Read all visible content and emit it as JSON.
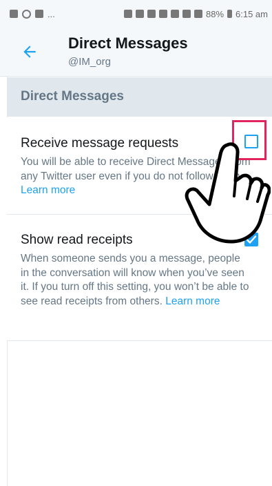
{
  "status_bar": {
    "left_dots": "...",
    "battery": "88%",
    "time": "6:15 am"
  },
  "header": {
    "title": "Direct Messages",
    "subtitle": "@IM_org"
  },
  "section": {
    "title": "Direct Messages"
  },
  "settings": [
    {
      "title": "Receive message requests",
      "description": "You will be able to receive Direct Messages from any Twitter user even if you do not follow them.",
      "link": "Learn more",
      "checked": false
    },
    {
      "title": "Show read receipts",
      "description": "When someone sends you a message, people in the conversation will know when you’ve seen it. If you turn off this setting, you won’t be able to see read receipts from others.",
      "link": "Learn more",
      "checked": true
    }
  ],
  "colors": {
    "accent": "#1da1f2",
    "highlight": "#e0245e",
    "section_bg": "#e1e8ed"
  },
  "icons": {
    "back": "back-arrow-icon",
    "cursor": "pointing-hand-cursor-icon"
  }
}
